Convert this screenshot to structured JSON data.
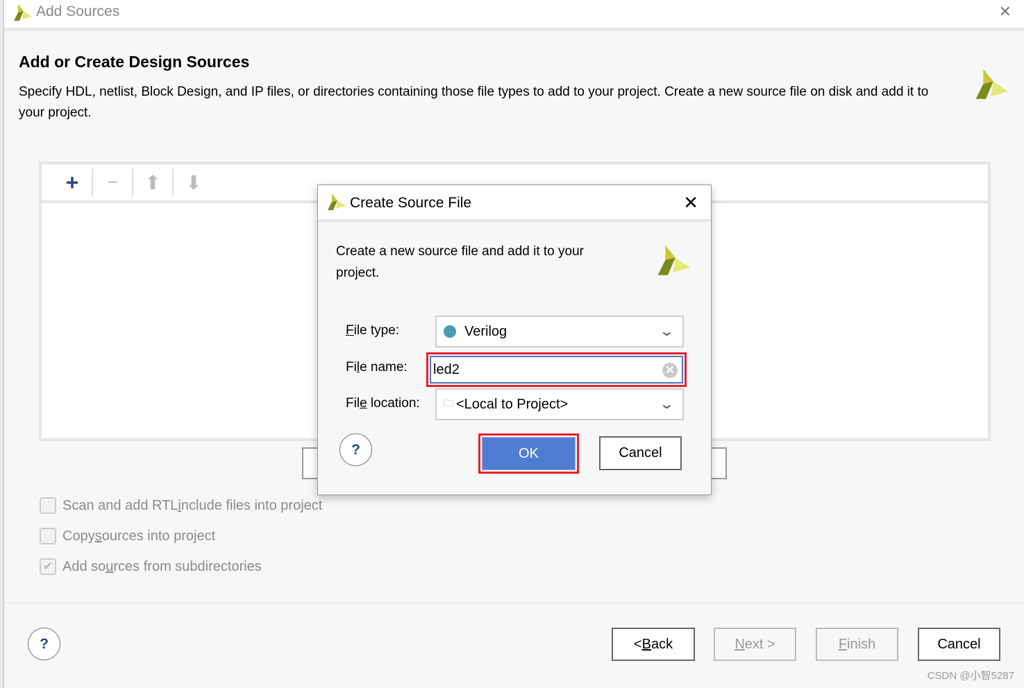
{
  "window": {
    "title": "Add Sources",
    "close_icon": "close-icon"
  },
  "heading": "Add or Create Design Sources",
  "description": "Specify HDL, netlist, Block Design, and IP files, or directories containing those file types to add to your project. Create a new source file on disk and add it to your project.",
  "toolbar": {
    "add": "+",
    "remove": "−",
    "up": "⬆",
    "down": "⬇"
  },
  "options": [
    {
      "pre": "Scan and add RTL ",
      "key": "i",
      "post": "nclude files into project",
      "checked": false
    },
    {
      "pre": "Copy ",
      "key": "s",
      "post": "ources into project",
      "checked": false
    },
    {
      "pre": "Add so",
      "key": "u",
      "post": "rces from subdirectories",
      "checked": true
    }
  ],
  "footer": {
    "help": "?",
    "back": {
      "pre": "< ",
      "key": "B",
      "post": "ack"
    },
    "next": {
      "pre": "",
      "key": "N",
      "post": "ext >"
    },
    "finish": {
      "pre": "",
      "key": "F",
      "post": "inish"
    },
    "cancel": "Cancel"
  },
  "dialog": {
    "title": "Create Source File",
    "description": "Create a new source file and add it to your project.",
    "file_type": {
      "pre": "",
      "key": "F",
      "post": "ile type:",
      "value": "Verilog",
      "dot_color": "#4a9ab0"
    },
    "file_name": {
      "pre": "Fi",
      "key": "l",
      "post": "e name:",
      "value": "led2"
    },
    "file_location": {
      "pre": "Fil",
      "key": "e",
      "post": " location:",
      "value": "<Local to Project>"
    },
    "help": "?",
    "ok": "OK",
    "cancel": "Cancel"
  },
  "watermark": "CSDN @小智5287",
  "colors": {
    "accent": "#4f7dd2",
    "highlight": "#e8202a"
  }
}
